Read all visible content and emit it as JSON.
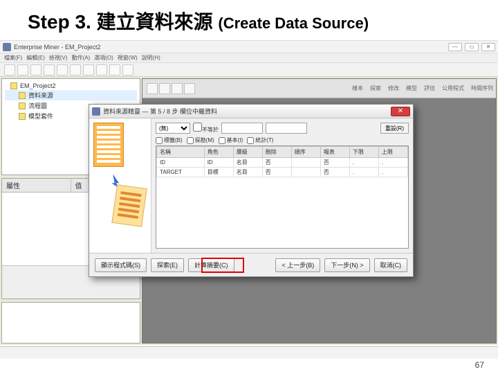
{
  "slide": {
    "title_prefix": "Step 3. ",
    "title_zh": "建立資料來源",
    "title_en": "(Create Data Source)",
    "page_number": "67"
  },
  "app": {
    "titlebar": "Enterprise Miner - EM_Project2",
    "winbtn_min": "—",
    "winbtn_max": "▭",
    "winbtn_close": "✕",
    "menu": [
      "檔案(F)",
      "編輯(E)",
      "檢視(V)",
      "動作(A)",
      "選項(O)",
      "視窗(W)",
      "說明(H)"
    ],
    "tree": {
      "root": "EM_Project2",
      "items": [
        "資料來源",
        "流程圖",
        "模型套件"
      ]
    },
    "props": {
      "col_name": "屬性",
      "col_value": "值"
    },
    "canvas_tabs": [
      "樣本",
      "探索",
      "修改",
      "模型",
      "評估",
      "公用程式",
      "時間序列"
    ]
  },
  "wizard": {
    "title": "資料來源精靈 — 第 5 / 8 步 欄位中繼資料",
    "close": "✕",
    "filter_row": {
      "eq_label": "(無)",
      "not_label": "不等於",
      "reset_btn": "重設(R)"
    },
    "checks": {
      "label_chk": "標籤(B)",
      "exploration_chk": "探勘(M)",
      "basic_chk": "基本(I)",
      "stats_chk": "統計(T)"
    },
    "grid": {
      "headers": [
        "名稱",
        "角色",
        "層級",
        "刪除",
        "順序",
        "報表",
        "下限",
        "上限"
      ],
      "rows": [
        {
          "name": "ID",
          "role": "ID",
          "level": "名目",
          "drop": "否",
          "order": "",
          "report": "否",
          "low": ".",
          "high": "."
        },
        {
          "name": "TARGET",
          "role": "目標",
          "level": "名目",
          "drop": "否",
          "order": "",
          "report": "否",
          "low": ".",
          "high": "."
        }
      ]
    },
    "footer": {
      "show_code": "顯示程式碼(S)",
      "explore": "探索(E)",
      "compute": "計算摘要(C)",
      "back": "< 上一步(B)",
      "next": "下一步(N) >",
      "cancel": "取消(C)"
    }
  }
}
